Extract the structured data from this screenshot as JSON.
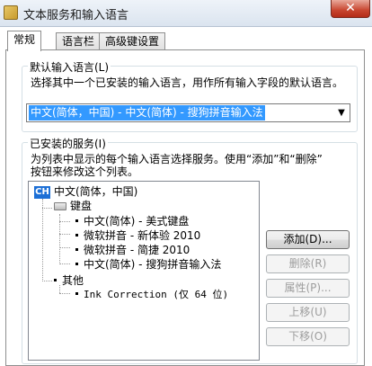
{
  "window": {
    "title": "文本服务和输入语言",
    "close_label": "✕"
  },
  "tabs": [
    {
      "label": "常规",
      "active": true
    },
    {
      "label": "语言栏",
      "active": false
    },
    {
      "label": "高级键设置",
      "active": false
    }
  ],
  "default_language": {
    "legend": "默认输入语言(L)",
    "description": "选择其中一个已安装的输入语言，用作所有输入字段的默认语言。",
    "selected": "中文(简体，中国) - 中文(简体) - 搜狗拼音输入法",
    "arrow": "▼"
  },
  "installed_services": {
    "legend": "已安装的服务(I)",
    "description_line1": "为列表中显示的每个输入语言选择服务。使用“添加”和“删除”",
    "description_line2": "按钮来修改这个列表。",
    "language_icon": "CH",
    "tree": {
      "language": "中文(简体，中国)",
      "keyboard_group": "键盘",
      "keyboards": [
        "中文(简体) - 美式键盘",
        "微软拼音 - 新体验 2010",
        "微软拼音 - 简捷 2010",
        "中文(简体) - 搜狗拼音输入法"
      ],
      "other_group": "其他",
      "others": [
        "Ink Correction (仅 64 位)"
      ]
    }
  },
  "buttons": {
    "add": "添加(D)...",
    "remove": "删除(R)",
    "properties": "属性(P)...",
    "move_up": "上移(U)",
    "move_down": "下移(O)"
  },
  "icons": {
    "window_icon": "keyboard-app-icon",
    "keyboard": "keyboard-icon",
    "language": "language-badge-icon"
  }
}
